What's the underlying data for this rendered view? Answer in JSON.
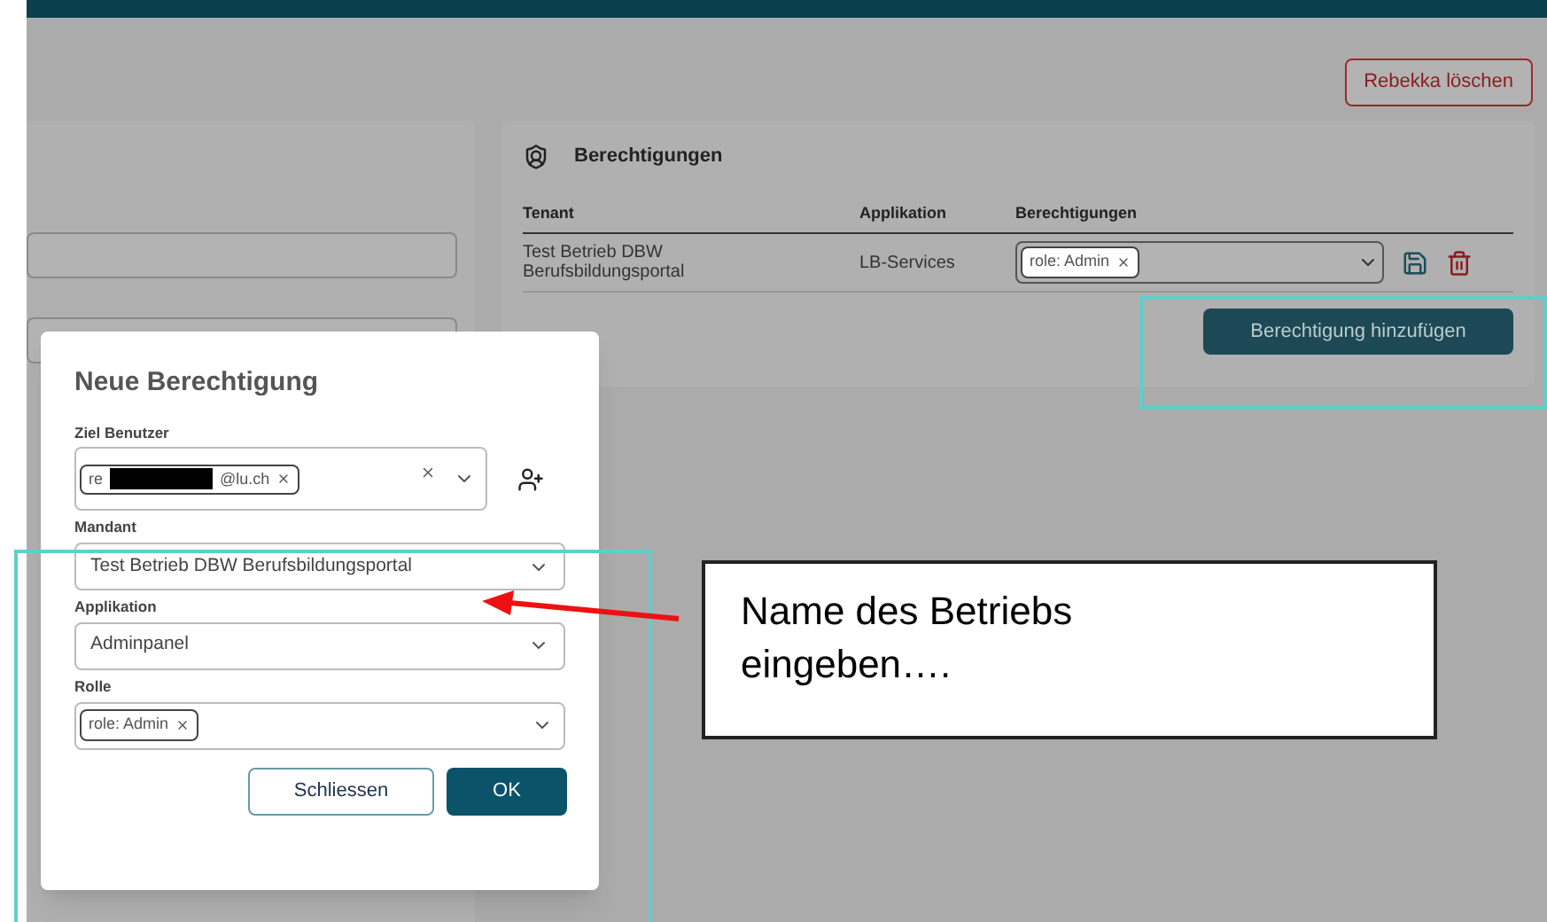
{
  "delete_button": "Rebekka löschen",
  "permissions": {
    "title": "Berechtigungen",
    "columns": [
      "Tenant",
      "Applikation",
      "Berechtigungen"
    ],
    "rows": [
      {
        "tenant": "Test Betrieb DBW Berufsbildungsportal",
        "application": "LB-Services",
        "roles": [
          "role: Admin"
        ]
      }
    ],
    "add_button": "Berechtigung hinzufügen"
  },
  "dialog": {
    "title": "Neue Berechtigung",
    "fields": [
      {
        "kind": "chips",
        "label": "Ziel Benutzer",
        "chips": [
          {
            "prefix": "re",
            "suffix": "@lu.ch",
            "redacted": true
          }
        ],
        "clearable": true
      },
      {
        "kind": "select",
        "label": "Mandant",
        "value": "Test Betrieb DBW Berufsbildungsportal"
      },
      {
        "kind": "select",
        "label": "Applikation",
        "value": "Adminpanel"
      },
      {
        "kind": "chips",
        "label": "Rolle",
        "chips": [
          {
            "prefix": "role: Admin",
            "redacted": false
          }
        ],
        "clearable": false
      }
    ],
    "buttons": [
      {
        "label": "Schliessen",
        "kind": "secondary"
      },
      {
        "label": "OK",
        "kind": "primary"
      }
    ]
  },
  "callout": {
    "text": "Name des Betriebs eingeben…."
  }
}
